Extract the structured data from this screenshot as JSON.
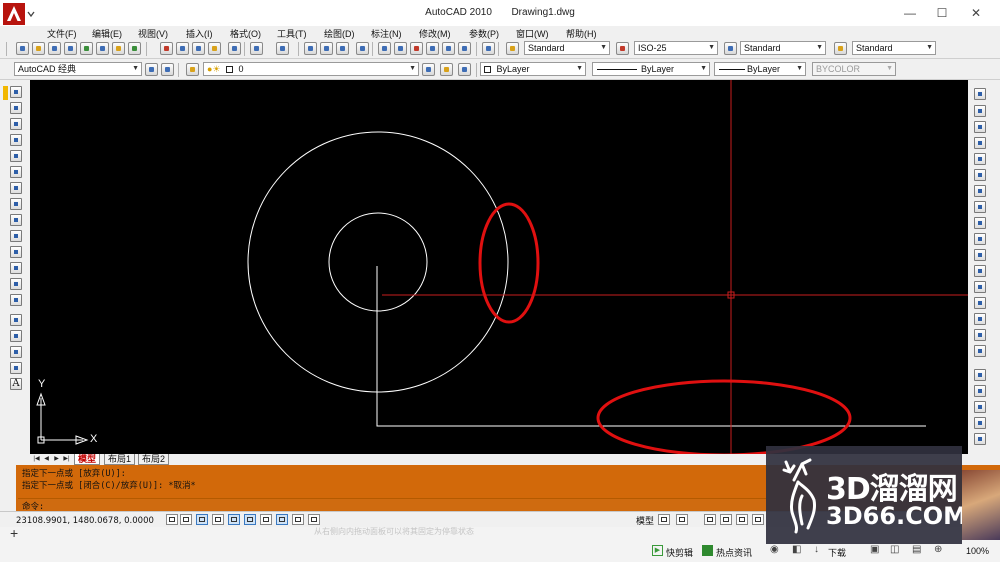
{
  "window": {
    "app_name": "AutoCAD 2010",
    "document": "Drawing1.dwg",
    "minimize_glyph": "—",
    "maximize_glyph": "☐",
    "close_glyph": "✕",
    "logo_icon": "autocad-logo-icon"
  },
  "menu": [
    "文件(F)",
    "编辑(E)",
    "视图(V)",
    "插入(I)",
    "格式(O)",
    "工具(T)",
    "绘图(D)",
    "标注(N)",
    "修改(M)",
    "参数(P)",
    "窗口(W)",
    "帮助(H)"
  ],
  "styles": {
    "text_style": "Standard",
    "dim_style": "ISO-25",
    "table_style": "Standard",
    "multileader_style": "Standard"
  },
  "layers": {
    "workspace": "AutoCAD 经典",
    "current_layer": "0",
    "color": "ByLayer",
    "linetype": "ByLayer",
    "lineweight": "ByLayer",
    "plotstyle": "BYCOLOR"
  },
  "ucs": {
    "x_label": "X",
    "y_label": "Y"
  },
  "layout_tabs": {
    "nav": [
      "|◀",
      "◀",
      "▶",
      "▶|"
    ],
    "tabs": [
      "模型",
      "布局1",
      "布局2"
    ],
    "active": "模型"
  },
  "command": {
    "history": [
      "指定下一点或 [放弃(U)]:",
      "指定下一点或 [闭合(C)/放弃(U)]: *取消*"
    ],
    "prompt": "命令:"
  },
  "status": {
    "coordinates": "23108.9901, 1480.0678, 0.0000",
    "space": "模型"
  },
  "host_bar": {
    "items": [
      "快剪辑",
      "热点资讯",
      "下载",
      "100%"
    ],
    "faded_text": "从右侧向内拖动面板可以将其固定为停靠状态"
  },
  "watermark": {
    "brand": "3D溜溜网",
    "domain": "3D66.COM"
  },
  "colors": {
    "canvas": "#000000",
    "geometry": "#ffffff",
    "crosshair": "#c81e1e",
    "highlight": "#e01010",
    "command_window": "#d2690a",
    "active_tab": "#c00000"
  },
  "icons": [
    "line-icon",
    "construction-line-icon",
    "polyline-icon",
    "polygon-icon",
    "rectangle-icon",
    "arc-icon",
    "circle-icon",
    "revision-cloud-icon",
    "spline-icon",
    "ellipse-icon",
    "insert-block-icon",
    "make-block-icon",
    "point-icon",
    "hatch-icon",
    "gradient-icon",
    "region-icon",
    "table-icon",
    "multiline-text-icon",
    "erase-icon",
    "copy-icon",
    "mirror-icon",
    "offset-icon",
    "array-icon",
    "move-icon",
    "rotate-icon",
    "scale-icon",
    "stretch-icon",
    "trim-icon",
    "extend-icon",
    "break-icon",
    "join-icon",
    "chamfer-icon",
    "fillet-icon",
    "explode-icon"
  ]
}
